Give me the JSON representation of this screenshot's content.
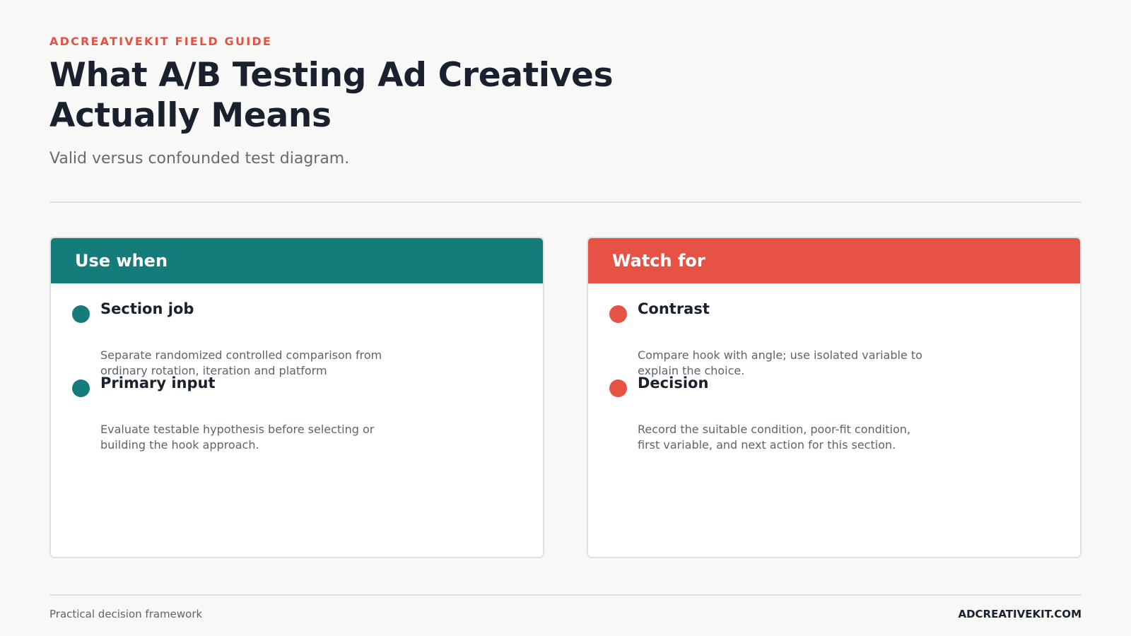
{
  "header": {
    "eyebrow": "ADCREATIVEKIT FIELD GUIDE",
    "title": "What A/B Testing Ad Creatives Actually Means",
    "subtitle": "Valid versus confounded test diagram."
  },
  "cards": [
    {
      "heading": "Use when",
      "color": "#147c7b",
      "items": [
        {
          "title": "Section job",
          "description": "Separate randomized controlled comparison from ordinary rotation, iteration and platform"
        },
        {
          "title": "Primary input",
          "description": "Evaluate testable hypothesis before selecting or building the hook approach."
        }
      ]
    },
    {
      "heading": "Watch for",
      "color": "#e65244",
      "items": [
        {
          "title": "Contrast",
          "description": "Compare hook with angle; use isolated variable to explain the choice."
        },
        {
          "title": "Decision",
          "description": "Record the suitable condition, poor-fit condition, first variable, and next action for this section."
        }
      ]
    }
  ],
  "footer": {
    "left": "Practical decision framework",
    "right": "ADCREATIVEKIT.COM"
  }
}
